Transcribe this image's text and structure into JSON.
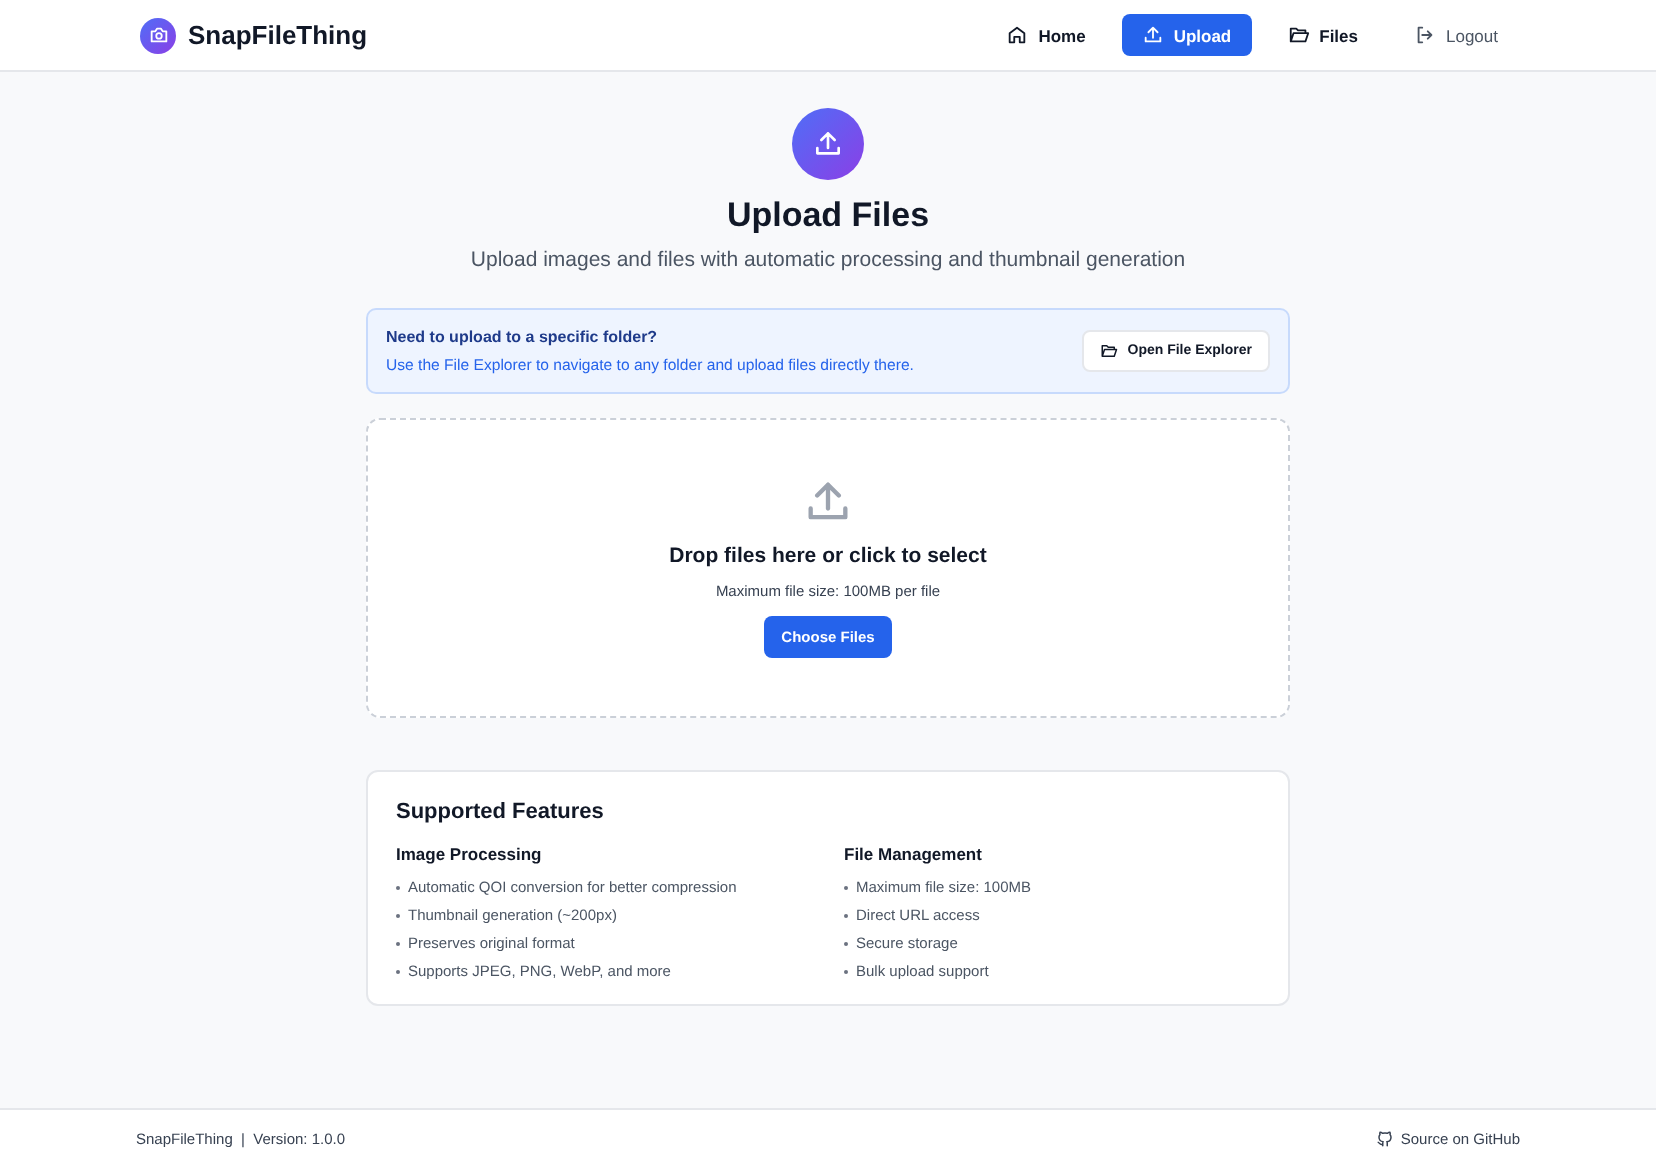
{
  "brand": {
    "name": "SnapFileThing"
  },
  "nav": [
    {
      "label": "Home",
      "selected": false
    },
    {
      "label": "Upload",
      "selected": true
    },
    {
      "label": "Files",
      "selected": false
    },
    {
      "label": "Logout",
      "selected": false
    }
  ],
  "hero": {
    "title": "Upload Files",
    "subtitle": "Upload images and files with automatic processing and thumbnail generation"
  },
  "notice": {
    "title": "Need to upload to a specific folder?",
    "text": "Use the File Explorer to navigate to any folder and upload files directly there.",
    "button": "Open File Explorer"
  },
  "dropzone": {
    "title": "Drop files here or click to select",
    "hint": "Maximum file size: 100MB per file",
    "button": "Choose Files"
  },
  "features": {
    "title": "Supported Features",
    "groups": [
      {
        "title": "Image Processing",
        "items": [
          "Automatic QOI conversion for better compression",
          "Thumbnail generation (~200px)",
          "Preserves original format",
          "Supports JPEG, PNG, WebP, and more"
        ]
      },
      {
        "title": "File Management",
        "items": [
          "Maximum file size: 100MB",
          "Direct URL access",
          "Secure storage",
          "Bulk upload support"
        ]
      }
    ]
  },
  "footer": {
    "text": "SnapFileThing  |  Version: 1.0.0",
    "link": "Source on GitHub"
  }
}
